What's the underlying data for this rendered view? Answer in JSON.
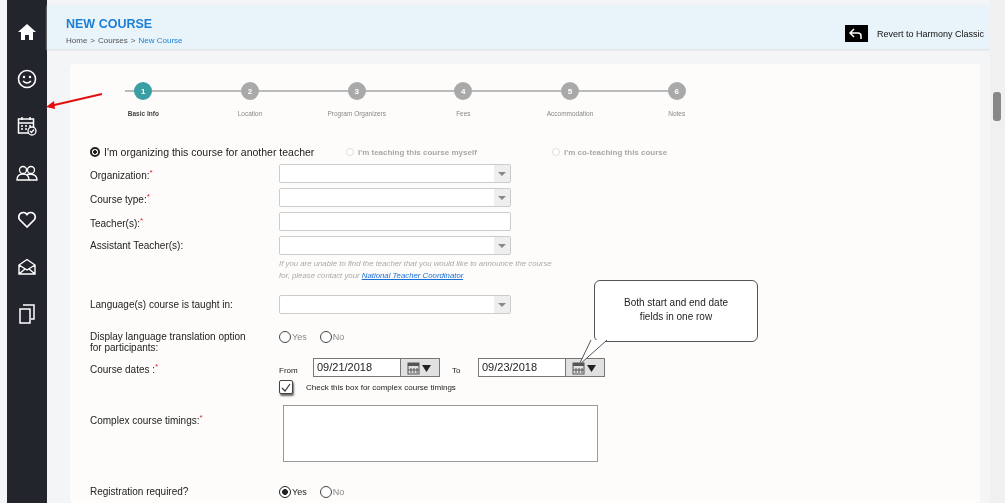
{
  "sidebar": {
    "items": [
      {
        "kind": "home"
      },
      {
        "kind": "smiley"
      },
      {
        "kind": "calendar"
      },
      {
        "kind": "people"
      },
      {
        "kind": "heart"
      },
      {
        "kind": "mail"
      },
      {
        "kind": "documents"
      }
    ]
  },
  "header": {
    "title": "NEW COURSE",
    "breadcrumb": [
      {
        "label": "Home",
        "current": false
      },
      {
        "label": "Courses",
        "current": false
      },
      {
        "label": "New Course",
        "current": true
      }
    ],
    "separator": ">",
    "revert_label": "Revert to Harmony Classic"
  },
  "steps": [
    {
      "number": "1",
      "label": "Basic Info",
      "selected": true
    },
    {
      "number": "2",
      "label": "Location",
      "selected": false
    },
    {
      "number": "3",
      "label": "Program Organizers",
      "selected": false
    },
    {
      "number": "4",
      "label": "Fees",
      "selected": false
    },
    {
      "number": "5",
      "label": "Accommodation",
      "selected": false
    },
    {
      "number": "6",
      "label": "Notes",
      "selected": false
    }
  ],
  "organizer_options": [
    {
      "label": "I'm organizing this course for another teacher",
      "selected": true,
      "disabled": false
    },
    {
      "label": "I'm teaching this course myself",
      "selected": false,
      "disabled": true
    },
    {
      "label": "I'm co-teaching this course",
      "selected": false,
      "disabled": true
    }
  ],
  "fields": [
    {
      "kind": "select",
      "label": "Organization:",
      "required": true
    },
    {
      "kind": "select",
      "label": "Course type:",
      "required": true
    },
    {
      "kind": "text",
      "label": "Teacher(s):",
      "required": true
    },
    {
      "kind": "select",
      "label": "Assistant Teacher(s):",
      "required": false,
      "hint": "If you are unable to find the teacher that you would like to announce the course for, please contact your",
      "hint_link": "National Teacher Coordinator",
      "hint_end": "."
    },
    {
      "kind": "select",
      "label": "Language(s) course is taught in:",
      "required": false
    },
    {
      "kind": "radio",
      "label": "Display language translation option for participants:",
      "required": false,
      "options": [
        {
          "label": "Yes",
          "selected": false
        },
        {
          "label": "No",
          "selected": false
        }
      ]
    },
    {
      "kind": "dates",
      "label": "Course dates :",
      "required": true,
      "from_label": "From",
      "from_value": "09/21/2018",
      "to_label": "To",
      "to_value": "09/23/2018",
      "checkbox": {
        "label": "Check this box for complex course timings",
        "checked": true
      }
    },
    {
      "kind": "textarea",
      "label": "Complex course timings:",
      "required": true
    },
    {
      "kind": "radio",
      "label": "Registration required?",
      "required": false,
      "options": [
        {
          "label": "Yes",
          "selected": true
        },
        {
          "label": "No",
          "selected": false
        }
      ]
    }
  ],
  "required_marker": "*",
  "callout": {
    "text": "Both start and end date fields in one row"
  }
}
